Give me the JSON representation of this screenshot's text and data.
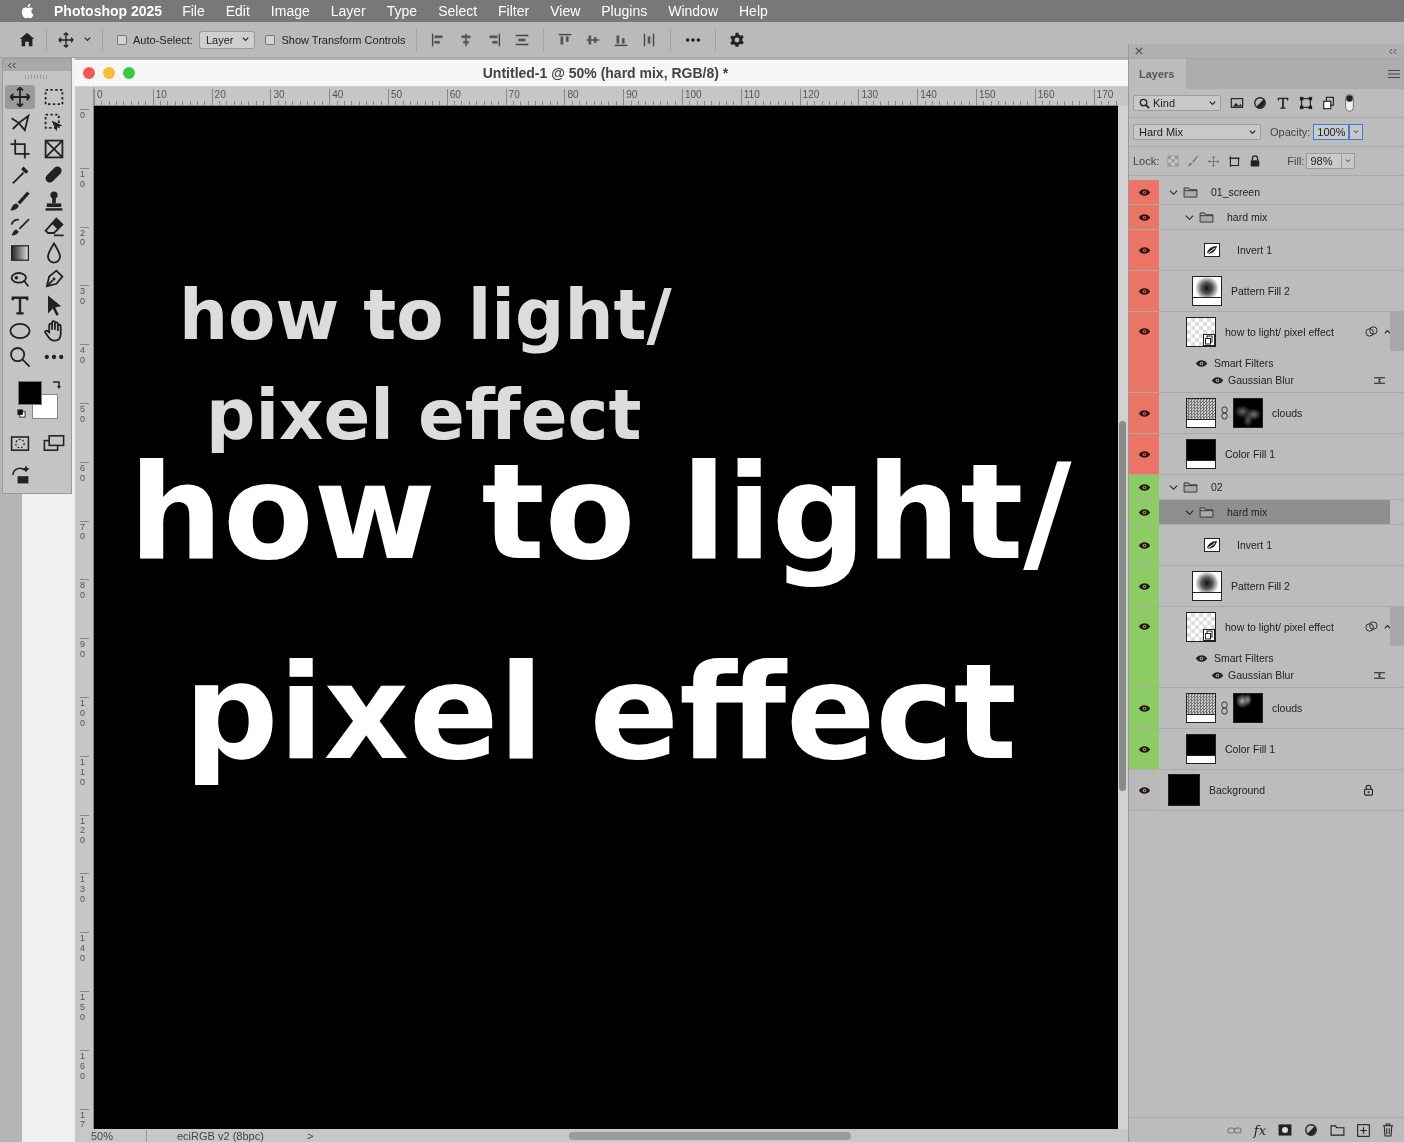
{
  "menu_bar": {
    "app_name": "Photoshop 2025",
    "items": [
      "File",
      "Edit",
      "Image",
      "Layer",
      "Type",
      "Select",
      "Filter",
      "View",
      "Plugins",
      "Window",
      "Help"
    ]
  },
  "options_bar": {
    "auto_select": {
      "label": "Auto-Select:",
      "checked": false
    },
    "target": "Layer",
    "show_transform": {
      "label": "Show Transform Controls",
      "checked": false
    }
  },
  "tools": [
    {
      "selected": true
    },
    {
      "selected": false
    },
    {
      "selected": false
    },
    {
      "selected": false
    },
    {
      "selected": false
    },
    {
      "selected": false
    },
    {
      "selected": false
    },
    {
      "selected": false
    },
    {
      "selected": false
    },
    {
      "selected": false
    },
    {
      "selected": false
    },
    {
      "selected": false
    },
    {
      "selected": false
    },
    {
      "selected": false
    },
    {
      "selected": false
    },
    {
      "selected": false
    },
    {
      "selected": false
    },
    {
      "selected": false
    },
    {
      "selected": false
    },
    {
      "selected": false
    },
    {
      "selected": false
    },
    {
      "selected": false
    }
  ],
  "document": {
    "title": "Untitled-1 @ 50% (hard mix, RGB/8) *",
    "ruler_h": [
      "0",
      "10",
      "20",
      "30",
      "40",
      "50",
      "60",
      "70",
      "80",
      "90",
      "100",
      "110",
      "120",
      "130",
      "140",
      "150",
      "160",
      "170"
    ],
    "ruler_v": [
      "0",
      "10",
      "20",
      "30",
      "40",
      "50",
      "60",
      "70",
      "80",
      "90",
      "100",
      "110",
      "120",
      "130",
      "140",
      "150",
      "160",
      "17"
    ],
    "canvas_text": [
      {
        "text": "how to light/",
        "kind": "small"
      },
      {
        "text": "pixel effect",
        "kind": "small"
      },
      {
        "text": "how to light/",
        "kind": "large"
      },
      {
        "text": "pixel effect",
        "kind": "large"
      }
    ]
  },
  "status_bar": {
    "zoom": "50%",
    "profile": "eciRGB v2 (8bpc)",
    "arrow": ">"
  },
  "layers_panel": {
    "tab": "Layers",
    "filter": "Kind",
    "blend_mode": "Hard Mix",
    "opacity_label": "Opacity:",
    "opacity": "100%",
    "lock_label": "Lock:",
    "fill_label": "Fill:",
    "fill": "98%",
    "footer_fx": "fx",
    "layers": [
      {
        "name": "01_screen",
        "kind": "group",
        "color": "#ea7567",
        "visible": true,
        "expanded": true,
        "selected": false,
        "children": [
          {
            "name": "hard mix",
            "kind": "group",
            "visible": true,
            "expanded": true,
            "selected": false,
            "children": [
              {
                "name": "Invert 1",
                "kind": "adjustment",
                "visible": true,
                "selected": false
              },
              {
                "name": "Pattern Fill 2",
                "kind": "pattern",
                "visible": true,
                "selected": false
              },
              {
                "name": "how to light/ pixel effect",
                "kind": "smart",
                "visible": true,
                "expanded": true,
                "selected": false,
                "filters": {
                  "label": "Smart Filters",
                  "visible": true,
                  "items": [
                    {
                      "name": "Gaussian Blur",
                      "visible": true
                    }
                  ]
                }
              },
              {
                "name": "clouds",
                "kind": "masked",
                "visible": true,
                "selected": false
              },
              {
                "name": "Color Fill 1",
                "kind": "solid",
                "visible": true,
                "selected": false
              }
            ]
          }
        ]
      },
      {
        "name": "02",
        "kind": "group",
        "color": "#8dcb64",
        "visible": true,
        "expanded": true,
        "selected": false,
        "children": [
          {
            "name": "hard mix",
            "kind": "group",
            "visible": true,
            "expanded": true,
            "selected": true,
            "children": [
              {
                "name": "Invert 1",
                "kind": "adjustment",
                "visible": true,
                "selected": false
              },
              {
                "name": "Pattern Fill 2",
                "kind": "pattern",
                "visible": true,
                "selected": false
              },
              {
                "name": "how to light/ pixel effect",
                "kind": "smart",
                "visible": true,
                "expanded": true,
                "selected": false,
                "filters": {
                  "label": "Smart Filters",
                  "visible": true,
                  "items": [
                    {
                      "name": "Gaussian Blur",
                      "visible": true
                    }
                  ]
                }
              },
              {
                "name": "clouds",
                "kind": "masked",
                "visible": true,
                "selected": false
              },
              {
                "name": "Color Fill 1",
                "kind": "solid",
                "visible": true,
                "selected": false
              }
            ]
          }
        ]
      },
      {
        "name": "Background",
        "kind": "background",
        "visible": true,
        "selected": false
      }
    ]
  }
}
